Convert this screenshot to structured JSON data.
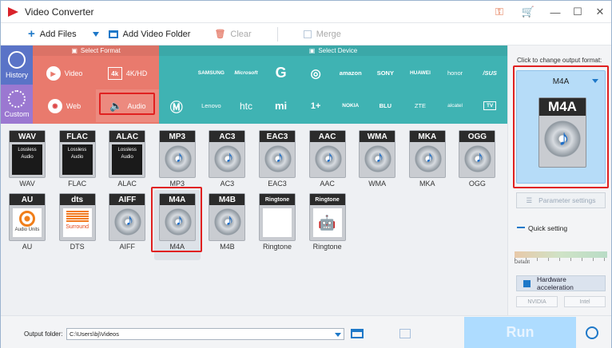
{
  "app": {
    "title": "Video Converter"
  },
  "toolbar": {
    "add_files": "Add Files",
    "add_video_folder": "Add Video Folder",
    "clear": "Clear",
    "merge": "Merge"
  },
  "leftnav": {
    "history": "History",
    "custom": "Custom"
  },
  "format_panel": {
    "header": "Select Format",
    "items": [
      "Video",
      "4K/HD",
      "Web",
      "Audio"
    ],
    "selected": "Audio"
  },
  "device_panel": {
    "header": "Select Device",
    "row1": [
      "",
      "SAMSUNG",
      "Microsoft",
      "G",
      "",
      "amazon",
      "SONY",
      "HUAWEI",
      "honor",
      "/SUS"
    ],
    "row2": [
      "",
      "Lenovo",
      "htc",
      "mi",
      "1+",
      "NOKIA",
      "BLU",
      "ZTE",
      "alcatel",
      "TV"
    ]
  },
  "formats": {
    "row1": [
      {
        "badge": "WAV",
        "name": "WAV",
        "style": "lossless",
        "sub": "Lossless Audio"
      },
      {
        "badge": "FLAC",
        "name": "FLAC",
        "style": "lossless",
        "sub": "Lossless Audio"
      },
      {
        "badge": "ALAC",
        "name": "ALAC",
        "style": "lossless",
        "sub": "Lossless Audio"
      },
      {
        "badge": "MP3",
        "name": "MP3",
        "style": "disc"
      },
      {
        "badge": "AC3",
        "name": "AC3",
        "style": "disc"
      },
      {
        "badge": "EAC3",
        "name": "EAC3",
        "style": "disc"
      },
      {
        "badge": "AAC",
        "name": "AAC",
        "style": "disc"
      },
      {
        "badge": "WMA",
        "name": "WMA",
        "style": "disc"
      },
      {
        "badge": "MKA",
        "name": "MKA",
        "style": "disc"
      },
      {
        "badge": "OGG",
        "name": "OGG",
        "style": "disc"
      }
    ],
    "row2": [
      {
        "badge": "AU",
        "name": "AU",
        "style": "au",
        "sub": "Audio Units"
      },
      {
        "badge": "dts",
        "name": "DTS",
        "style": "dts",
        "sub": "Surround"
      },
      {
        "badge": "AIFF",
        "name": "AIFF",
        "style": "disc"
      },
      {
        "badge": "M4A",
        "name": "M4A",
        "style": "disc"
      },
      {
        "badge": "M4B",
        "name": "M4B",
        "style": "disc"
      },
      {
        "badge": "Ringtone",
        "name": "Ringtone",
        "style": "apple"
      },
      {
        "badge": "Ringtone",
        "name": "Ringtone",
        "style": "android"
      }
    ],
    "selected": "M4A"
  },
  "right_panel": {
    "click_to_change": "Click to change output format:",
    "output_format": "M4A",
    "parameter_settings": "Parameter settings",
    "quick_setting": "Quick setting",
    "default_label": "Default",
    "hardware_acceleration": "Hardware acceleration",
    "nvidia": "NVIDIA",
    "intel": "Intel"
  },
  "bottom": {
    "output_folder_label": "Output folder:",
    "output_folder_path": "C:\\Users\\bj\\Videos",
    "run": "Run"
  },
  "colors": {
    "format_panel": "#e97a6d",
    "device_panel": "#3fb3b3",
    "history_nav": "#5a73c7",
    "custom_nav": "#9b78d1",
    "highlight": "#e02020",
    "accent": "#1e78c8"
  }
}
